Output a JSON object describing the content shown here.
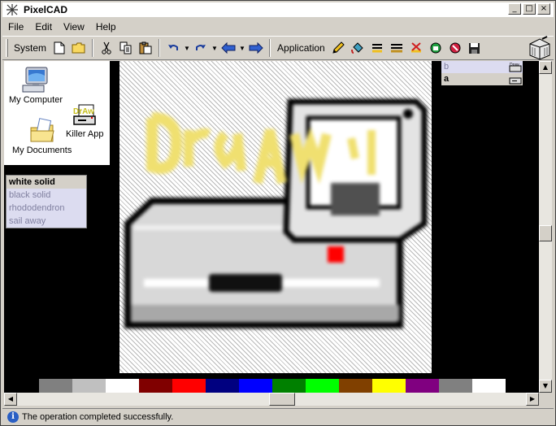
{
  "window": {
    "title": "PixelCAD"
  },
  "title_buttons": {
    "minimize": "_",
    "maximize": "□",
    "close": "×"
  },
  "menu": [
    "File",
    "Edit",
    "View",
    "Help"
  ],
  "toolbar": {
    "system_label": "System",
    "application_label": "Application"
  },
  "desktop": {
    "items": [
      {
        "label": "My Computer",
        "icon": "computer-icon"
      },
      {
        "label": "Killer App",
        "icon": "drawing-app-icon"
      },
      {
        "label": "My Documents",
        "icon": "folder-documents-icon"
      }
    ]
  },
  "styles": {
    "items": [
      "white solid",
      "black solid",
      "rhododendron",
      "sail away"
    ],
    "selected": "white solid"
  },
  "layers": {
    "items": [
      {
        "label": "b",
        "selected": false
      },
      {
        "label": "a",
        "selected": true
      }
    ]
  },
  "palette": [
    "#808080",
    "#c0c0c0",
    "#ffffff",
    "#800000",
    "#ff0000",
    "#000080",
    "#0000ff",
    "#008000",
    "#00ff00",
    "#804000",
    "#ffff00",
    "#800080",
    "#808080",
    "#ffffff"
  ],
  "status": {
    "message": "The operation completed successfully."
  },
  "colors": {
    "canvas_hatch": "#b8b8b8",
    "selection": "#d4d0c8",
    "list_bg": "#dcdcf0"
  }
}
